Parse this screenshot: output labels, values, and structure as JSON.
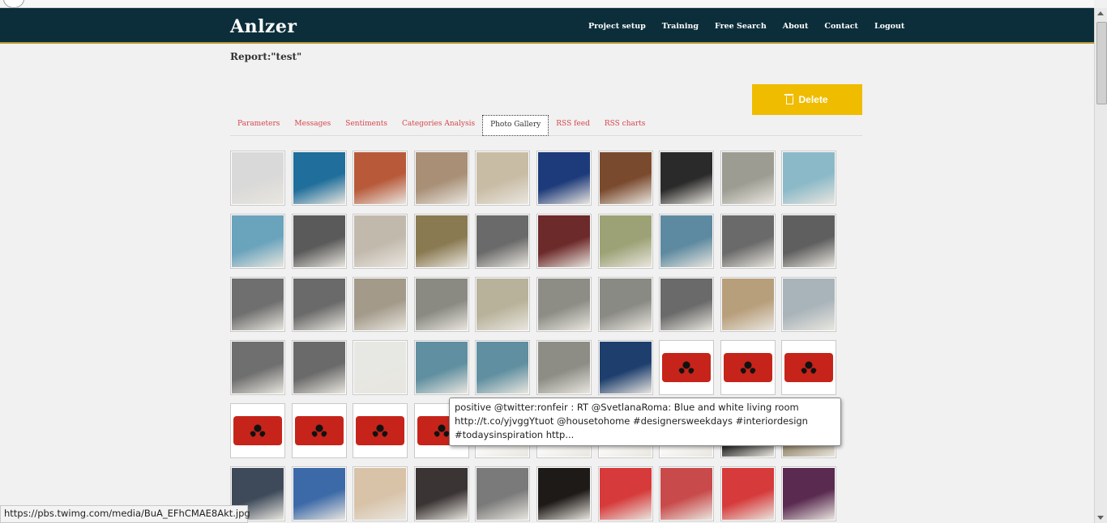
{
  "app": {
    "brand": "Anlzer",
    "nav": [
      {
        "label": "Project setup"
      },
      {
        "label": "Training"
      },
      {
        "label": "Free Search"
      },
      {
        "label": "About"
      },
      {
        "label": "Contact"
      },
      {
        "label": "Logout"
      }
    ]
  },
  "report": {
    "title": "Report:\"test\"",
    "delete_label": "Delete"
  },
  "tabs": [
    {
      "label": "Parameters"
    },
    {
      "label": "Messages"
    },
    {
      "label": "Sentiments"
    },
    {
      "label": "Categories Analysis"
    },
    {
      "label": "Photo Gallery",
      "active": true
    },
    {
      "label": "RSS feed"
    },
    {
      "label": "RSS charts"
    }
  ],
  "gallery": {
    "rows": [
      [
        "#d9d9d9",
        "#1f6e9b",
        "#b85a3a",
        "#a88f76",
        "#c9bca5",
        "#1d3a7a",
        "#7a4a2e",
        "#2a2a2a",
        "#9c9c92",
        "#8bb9c8"
      ],
      [
        "#6aa3bc",
        "#5a5a5a",
        "#c2b9ad",
        "#8a7a52",
        "#6a6a6a",
        "#6d2a2a",
        "#9da276",
        "#5d8aa0",
        "#6a6a6a",
        "#5f5f5f"
      ],
      [
        "#6f6f6f",
        "#6a6a6a",
        "#a39a8a",
        "#8a8a82",
        "#b8b29a",
        "#8d8d86",
        "#8a8a84",
        "#6a6a6a",
        "#b89f7c",
        "#a9b4ba"
      ],
      [
        "#6f6f6f",
        "#6a6a6a",
        "#e7e7e3",
        "#5f8fa0",
        "#5f8fa0",
        "#8d8d86",
        "#1e3f6e",
        "red",
        "red",
        "red"
      ],
      [
        "red",
        "red",
        "red",
        "red",
        "#ffffff",
        "#ffffff",
        "#ffffff",
        "#ffffff",
        "#101010",
        "#8a7b5e"
      ],
      [
        "#3e4a5a",
        "#3c6aa8",
        "#d8c2a8",
        "#3a3434",
        "#7a7a7a",
        "#1e1a18",
        "#d63a3a",
        "#c84a4a",
        "#d63a3a",
        "#5a2a50"
      ]
    ]
  },
  "tooltip": {
    "text": "positive @twitter:ronfeir : RT @SvetlanaRoma: Blue and white living room http://t.co/yjvggYtuot @housetohome #designersweekdays #interiordesign #todaysinspiration http..."
  },
  "status": {
    "url": "https://pbs.twimg.com/media/BuA_EFhCMAE8Akt.jpg"
  }
}
